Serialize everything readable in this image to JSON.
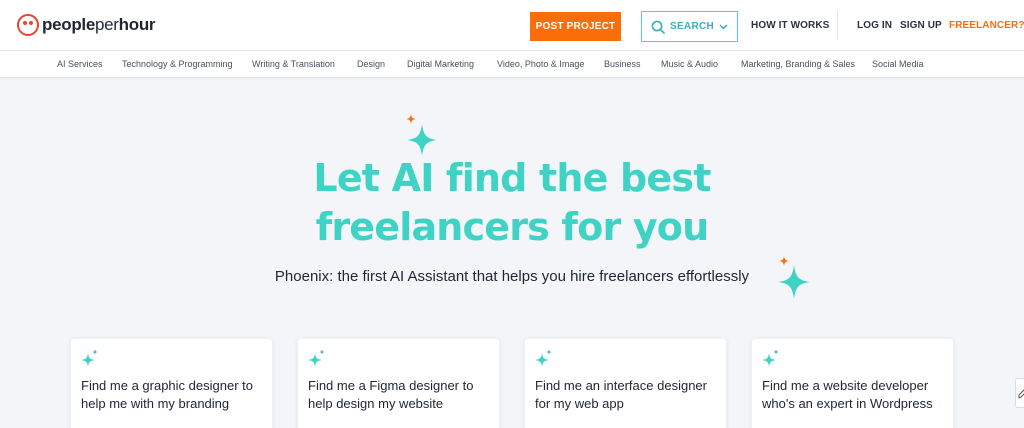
{
  "brand": {
    "part1": "people",
    "part2": "per",
    "part3": "hour",
    "color": "#e8452c"
  },
  "header": {
    "post_project": "POST PROJECT",
    "search": "SEARCH",
    "how_it_works": "HOW IT WORKS",
    "log_in": "LOG IN",
    "sign_up": "SIGN UP",
    "freelancer": "FREELANCER?"
  },
  "categories": [
    "AI Services",
    "Technology & Programming",
    "Writing & Translation",
    "Design",
    "Digital Marketing",
    "Video, Photo & Image",
    "Business",
    "Music & Audio",
    "Marketing, Branding & Sales",
    "Social Media"
  ],
  "hero": {
    "title_line1": "Let AI find the best",
    "title_line2": "freelancers for you",
    "subtitle": "Phoenix: the first AI Assistant that helps you hire freelancers effortlessly"
  },
  "cards": [
    {
      "text": "Find me a graphic designer to help me with my branding"
    },
    {
      "text": "Find me a Figma designer to help design my website"
    },
    {
      "text": "Find me an interface designer for my web app"
    },
    {
      "text": "Find me a website developer who's an expert in Wordpress"
    }
  ],
  "colors": {
    "accent_orange": "#fa6e0a",
    "accent_teal": "#3fd3c6",
    "search_teal": "#3aaec4"
  },
  "icons": [
    "logo-icon",
    "search-icon",
    "chevron-down-icon",
    "sparkle-icon",
    "sparkle-small-icon",
    "feedback-icon"
  ]
}
